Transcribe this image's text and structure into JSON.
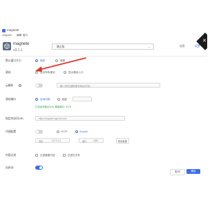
{
  "window": {
    "app_title": "magnete"
  },
  "menubar": {
    "items": [
      "magnete",
      "编辑",
      "窗口"
    ]
  },
  "header": {
    "package_name": "magnete",
    "version": "v3.1.1",
    "version_select": "最近版",
    "link_start": "启用",
    "link_settings": "设置"
  },
  "rows": {
    "r1": {
      "label": "默认窗口大小",
      "opt1": "明亮",
      "opt2": "暗黑"
    },
    "r2": {
      "label": "源站",
      "opt1": "显示所有源站",
      "opt2": "显示源站入口"
    },
    "r3": {
      "label": "云解析",
      "placeholder": "输入你的云解析服务地址(可选)"
    },
    "r4": {
      "label": "源站端口",
      "opt1": "自动切换",
      "opt2": "固定",
      "port_value": "",
      "hint": "已自动分配(6220), 原始端口: 4176"
    },
    "r5": {
      "label": "指定的访问URL",
      "value": "https://magnete.agencrt.com"
    },
    "r6": {
      "label": "代理配置",
      "opt1": "HTTP",
      "opt2": "Socks5",
      "addr_label": "地址",
      "addr_value": "127.0.0.1",
      "port_label": "端口",
      "port_value": "1080",
      "check_btn": "检测连通"
    },
    "r7": {
      "label": "内容过滤",
      "opt1": "过滤重复内容",
      "opt2": "过滤空文件"
    },
    "r8": {
      "label": "自启动"
    }
  },
  "footer": {
    "cancel": "取消",
    "ok": "确定"
  },
  "colors": {
    "accent": "#3b6df0",
    "hint_green": "#2f9a41",
    "annotation_red": "#e0352b"
  }
}
